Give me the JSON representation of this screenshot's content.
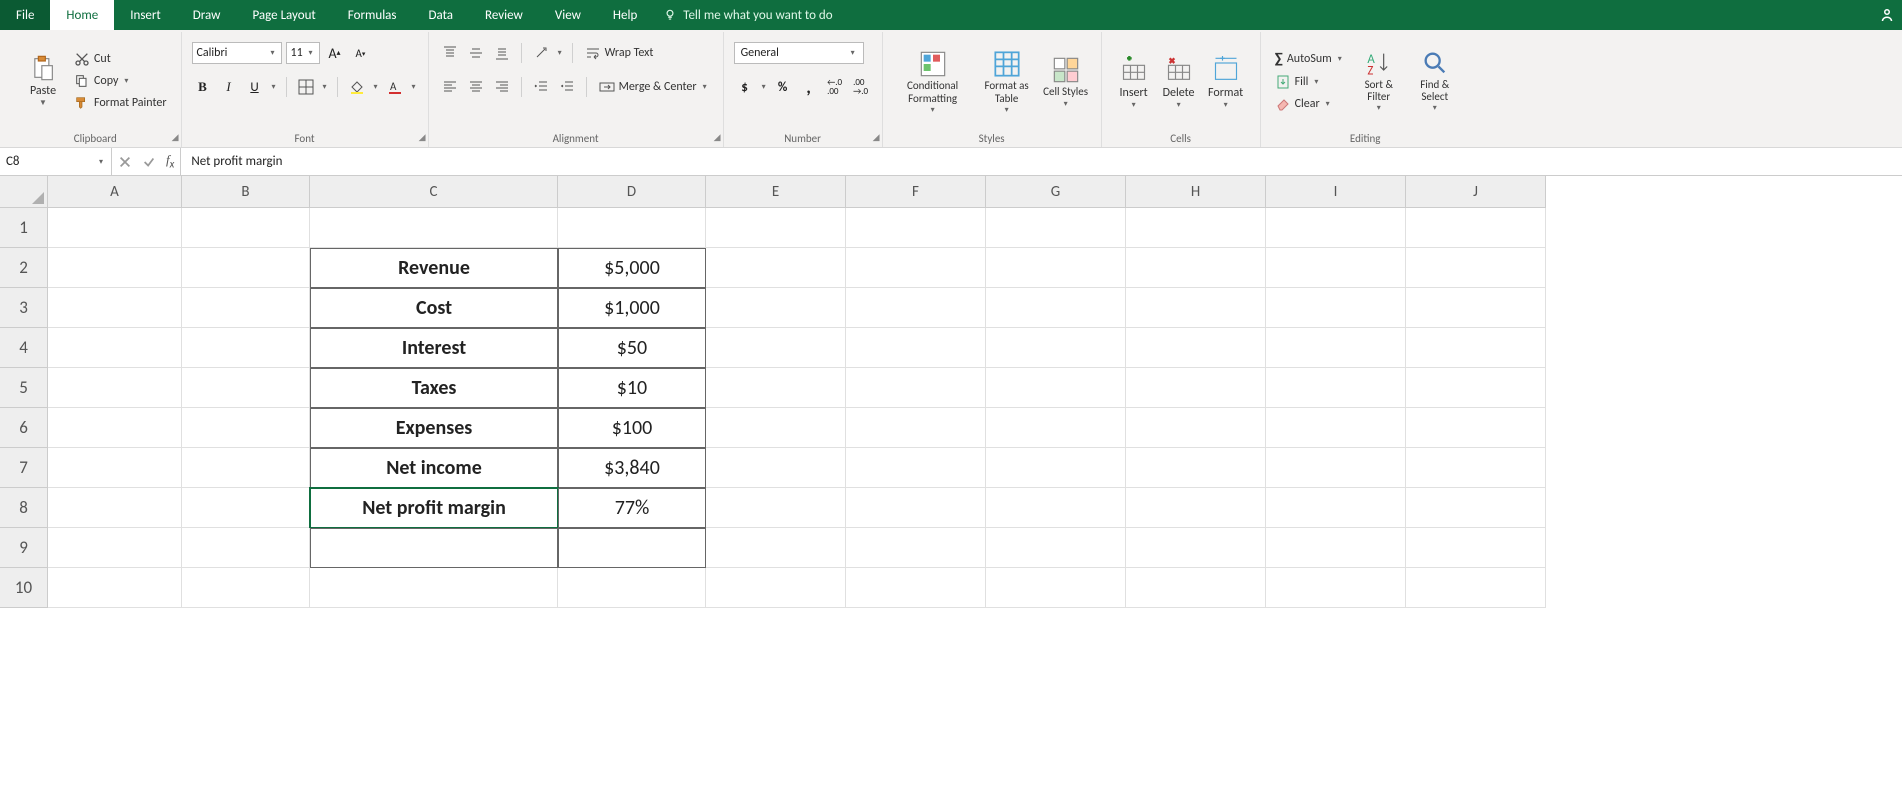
{
  "menu": {
    "file": "File",
    "home": "Home",
    "insert": "Insert",
    "draw": "Draw",
    "page_layout": "Page Layout",
    "formulas": "Formulas",
    "data": "Data",
    "review": "Review",
    "view": "View",
    "help": "Help",
    "tell_me": "Tell me what you want to do"
  },
  "ribbon": {
    "clipboard": {
      "label": "Clipboard",
      "paste": "Paste",
      "cut": "Cut",
      "copy": "Copy",
      "format_painter": "Format Painter"
    },
    "font": {
      "label": "Font",
      "name": "Calibri",
      "size": "11"
    },
    "alignment": {
      "label": "Alignment",
      "wrap": "Wrap Text",
      "merge": "Merge & Center"
    },
    "number": {
      "label": "Number",
      "fmt": "General"
    },
    "styles": {
      "label": "Styles",
      "cond": "Conditional Formatting",
      "fas": "Format as Table",
      "cell": "Cell Styles"
    },
    "cells": {
      "label": "Cells",
      "insert": "Insert",
      "delete": "Delete",
      "format": "Format"
    },
    "editing": {
      "label": "Editing",
      "autosum": "AutoSum",
      "fill": "Fill",
      "clear": "Clear",
      "sort": "Sort & Filter",
      "find": "Find & Select"
    }
  },
  "formula_bar": {
    "cell_ref": "C8",
    "value": "Net profit margin"
  },
  "columns": [
    "A",
    "B",
    "C",
    "D",
    "E",
    "F",
    "G",
    "H",
    "I",
    "J"
  ],
  "rows": [
    "1",
    "2",
    "3",
    "4",
    "5",
    "6",
    "7",
    "8",
    "9",
    "10"
  ],
  "sheet": {
    "r2": {
      "label": "Revenue",
      "val": "$5,000"
    },
    "r3": {
      "label": "Cost",
      "val": "$1,000"
    },
    "r4": {
      "label": "Interest",
      "val": "$50"
    },
    "r5": {
      "label": "Taxes",
      "val": "$10"
    },
    "r6": {
      "label": "Expenses",
      "val": "$100"
    },
    "r7": {
      "label": "Net income",
      "val": "$3,840"
    },
    "r8": {
      "label": "Net profit margin",
      "val": "77%"
    }
  }
}
